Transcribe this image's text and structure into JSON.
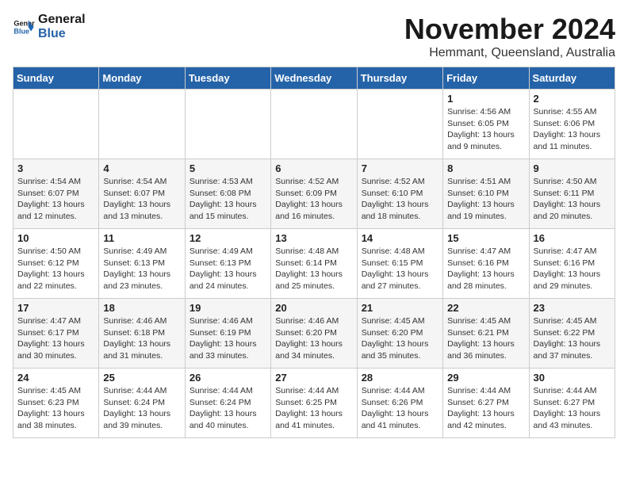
{
  "logo": {
    "line1": "General",
    "line2": "Blue"
  },
  "title": "November 2024",
  "subtitle": "Hemmant, Queensland, Australia",
  "days_header": [
    "Sunday",
    "Monday",
    "Tuesday",
    "Wednesday",
    "Thursday",
    "Friday",
    "Saturday"
  ],
  "weeks": [
    [
      {
        "day": "",
        "info": ""
      },
      {
        "day": "",
        "info": ""
      },
      {
        "day": "",
        "info": ""
      },
      {
        "day": "",
        "info": ""
      },
      {
        "day": "",
        "info": ""
      },
      {
        "day": "1",
        "info": "Sunrise: 4:56 AM\nSunset: 6:05 PM\nDaylight: 13 hours\nand 9 minutes."
      },
      {
        "day": "2",
        "info": "Sunrise: 4:55 AM\nSunset: 6:06 PM\nDaylight: 13 hours\nand 11 minutes."
      }
    ],
    [
      {
        "day": "3",
        "info": "Sunrise: 4:54 AM\nSunset: 6:07 PM\nDaylight: 13 hours\nand 12 minutes."
      },
      {
        "day": "4",
        "info": "Sunrise: 4:54 AM\nSunset: 6:07 PM\nDaylight: 13 hours\nand 13 minutes."
      },
      {
        "day": "5",
        "info": "Sunrise: 4:53 AM\nSunset: 6:08 PM\nDaylight: 13 hours\nand 15 minutes."
      },
      {
        "day": "6",
        "info": "Sunrise: 4:52 AM\nSunset: 6:09 PM\nDaylight: 13 hours\nand 16 minutes."
      },
      {
        "day": "7",
        "info": "Sunrise: 4:52 AM\nSunset: 6:10 PM\nDaylight: 13 hours\nand 18 minutes."
      },
      {
        "day": "8",
        "info": "Sunrise: 4:51 AM\nSunset: 6:10 PM\nDaylight: 13 hours\nand 19 minutes."
      },
      {
        "day": "9",
        "info": "Sunrise: 4:50 AM\nSunset: 6:11 PM\nDaylight: 13 hours\nand 20 minutes."
      }
    ],
    [
      {
        "day": "10",
        "info": "Sunrise: 4:50 AM\nSunset: 6:12 PM\nDaylight: 13 hours\nand 22 minutes."
      },
      {
        "day": "11",
        "info": "Sunrise: 4:49 AM\nSunset: 6:13 PM\nDaylight: 13 hours\nand 23 minutes."
      },
      {
        "day": "12",
        "info": "Sunrise: 4:49 AM\nSunset: 6:13 PM\nDaylight: 13 hours\nand 24 minutes."
      },
      {
        "day": "13",
        "info": "Sunrise: 4:48 AM\nSunset: 6:14 PM\nDaylight: 13 hours\nand 25 minutes."
      },
      {
        "day": "14",
        "info": "Sunrise: 4:48 AM\nSunset: 6:15 PM\nDaylight: 13 hours\nand 27 minutes."
      },
      {
        "day": "15",
        "info": "Sunrise: 4:47 AM\nSunset: 6:16 PM\nDaylight: 13 hours\nand 28 minutes."
      },
      {
        "day": "16",
        "info": "Sunrise: 4:47 AM\nSunset: 6:16 PM\nDaylight: 13 hours\nand 29 minutes."
      }
    ],
    [
      {
        "day": "17",
        "info": "Sunrise: 4:47 AM\nSunset: 6:17 PM\nDaylight: 13 hours\nand 30 minutes."
      },
      {
        "day": "18",
        "info": "Sunrise: 4:46 AM\nSunset: 6:18 PM\nDaylight: 13 hours\nand 31 minutes."
      },
      {
        "day": "19",
        "info": "Sunrise: 4:46 AM\nSunset: 6:19 PM\nDaylight: 13 hours\nand 33 minutes."
      },
      {
        "day": "20",
        "info": "Sunrise: 4:46 AM\nSunset: 6:20 PM\nDaylight: 13 hours\nand 34 minutes."
      },
      {
        "day": "21",
        "info": "Sunrise: 4:45 AM\nSunset: 6:20 PM\nDaylight: 13 hours\nand 35 minutes."
      },
      {
        "day": "22",
        "info": "Sunrise: 4:45 AM\nSunset: 6:21 PM\nDaylight: 13 hours\nand 36 minutes."
      },
      {
        "day": "23",
        "info": "Sunrise: 4:45 AM\nSunset: 6:22 PM\nDaylight: 13 hours\nand 37 minutes."
      }
    ],
    [
      {
        "day": "24",
        "info": "Sunrise: 4:45 AM\nSunset: 6:23 PM\nDaylight: 13 hours\nand 38 minutes."
      },
      {
        "day": "25",
        "info": "Sunrise: 4:44 AM\nSunset: 6:24 PM\nDaylight: 13 hours\nand 39 minutes."
      },
      {
        "day": "26",
        "info": "Sunrise: 4:44 AM\nSunset: 6:24 PM\nDaylight: 13 hours\nand 40 minutes."
      },
      {
        "day": "27",
        "info": "Sunrise: 4:44 AM\nSunset: 6:25 PM\nDaylight: 13 hours\nand 41 minutes."
      },
      {
        "day": "28",
        "info": "Sunrise: 4:44 AM\nSunset: 6:26 PM\nDaylight: 13 hours\nand 41 minutes."
      },
      {
        "day": "29",
        "info": "Sunrise: 4:44 AM\nSunset: 6:27 PM\nDaylight: 13 hours\nand 42 minutes."
      },
      {
        "day": "30",
        "info": "Sunrise: 4:44 AM\nSunset: 6:27 PM\nDaylight: 13 hours\nand 43 minutes."
      }
    ]
  ]
}
